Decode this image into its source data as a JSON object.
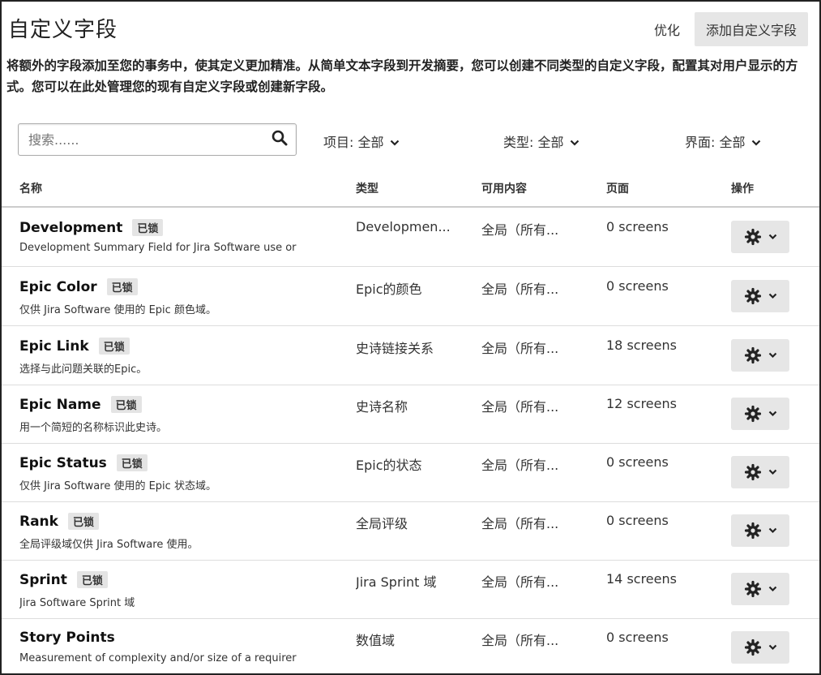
{
  "header": {
    "title": "自定义字段",
    "optimize_label": "优化",
    "add_button_label": "添加自定义字段"
  },
  "description": "将额外的字段添加至您的事务中，使其定义更加精准。从简单文本字段到开发摘要，您可以创建不同类型的自定义字段，配置其对用户显示的方式。您可以在此处管理您的现有自定义字段或创建新字段。",
  "filters": {
    "search_placeholder": "搜索......",
    "project": "项目: 全部",
    "type": "类型: 全部",
    "screen": "界面: 全部"
  },
  "columns": {
    "name": "名称",
    "type": "类型",
    "context": "可用内容",
    "screens": "页面",
    "actions": "操作"
  },
  "rows": [
    {
      "name": "Development",
      "lock": "已锁",
      "desc": "Development Summary Field for Jira Software use or",
      "type": "Developmen...",
      "context": "全局（所有...",
      "screens": "0 screens"
    },
    {
      "name": "Epic Color",
      "lock": "已锁",
      "desc": "仅供 Jira Software 使用的 Epic 颜色域。",
      "type": "Epic的颜色",
      "context": "全局（所有...",
      "screens": "0 screens"
    },
    {
      "name": "Epic Link",
      "lock": "已锁",
      "desc": "选择与此问题关联的Epic。",
      "type": "史诗链接关系",
      "context": "全局（所有...",
      "screens": "18 screens"
    },
    {
      "name": "Epic Name",
      "lock": "已锁",
      "desc": "用一个简短的名称标识此史诗。",
      "type": "史诗名称",
      "context": "全局（所有...",
      "screens": "12 screens"
    },
    {
      "name": "Epic Status",
      "lock": "已锁",
      "desc": "仅供 Jira Software 使用的 Epic 状态域。",
      "type": "Epic的状态",
      "context": "全局（所有...",
      "screens": "0 screens"
    },
    {
      "name": "Rank",
      "lock": "已锁",
      "desc": "全局评级域仅供 Jira Software 使用。",
      "type": "全局评级",
      "context": "全局（所有...",
      "screens": "0 screens"
    },
    {
      "name": "Sprint",
      "lock": "已锁",
      "desc": "Jira Software Sprint 域",
      "type": "Jira Sprint 域",
      "context": "全局（所有...",
      "screens": "14 screens"
    },
    {
      "name": "Story Points",
      "lock": "",
      "desc": "Measurement of complexity and/or size of a requirer",
      "type": "数值域",
      "context": "全局（所有...",
      "screens": "0 screens"
    }
  ]
}
